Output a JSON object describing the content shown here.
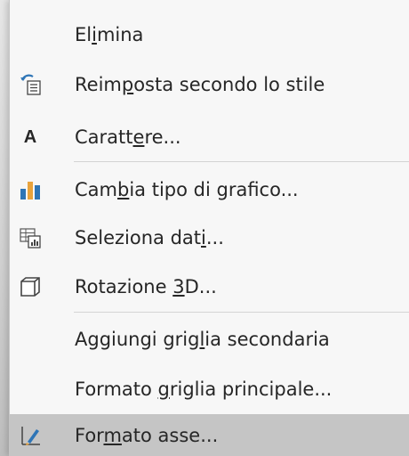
{
  "menu": {
    "items": [
      {
        "id": "elimina",
        "pre": "El",
        "acc": "i",
        "post": "mina",
        "icon": null
      },
      {
        "id": "reimposta",
        "pre": "Reim",
        "acc": "p",
        "post": "osta secondo lo stile",
        "icon": "reset-style-icon"
      },
      {
        "id": "carattere",
        "pre": "Caratt",
        "acc": "e",
        "post": "re...",
        "icon": "font-icon"
      },
      {
        "id": "cambia-tipo",
        "pre": "Cam",
        "acc": "b",
        "post": "ia tipo di grafico...",
        "icon": "chart-type-icon"
      },
      {
        "id": "seleziona-dati",
        "pre": "Seleziona dat",
        "acc": "i",
        "post": "...",
        "icon": "select-data-icon"
      },
      {
        "id": "rotazione-3d",
        "pre": "Rotazione ",
        "acc": "3",
        "post": "D...",
        "icon": "rotation-3d-icon"
      },
      {
        "id": "aggiungi-griglia",
        "pre": "Aggiungi grig",
        "acc": "l",
        "post": "ia secondaria",
        "icon": null
      },
      {
        "id": "formato-griglia",
        "pre": "Formato ",
        "acc": "g",
        "post": "riglia principale...",
        "icon": null
      },
      {
        "id": "formato-asse",
        "pre": "For",
        "acc": "m",
        "post": "ato asse...",
        "icon": "format-axis-icon"
      }
    ],
    "font_icon_glyph": "A",
    "highlight_color": "#c5c5c5",
    "accent_blue": "#2e75b6",
    "accent_orange": "#e8a33d"
  }
}
